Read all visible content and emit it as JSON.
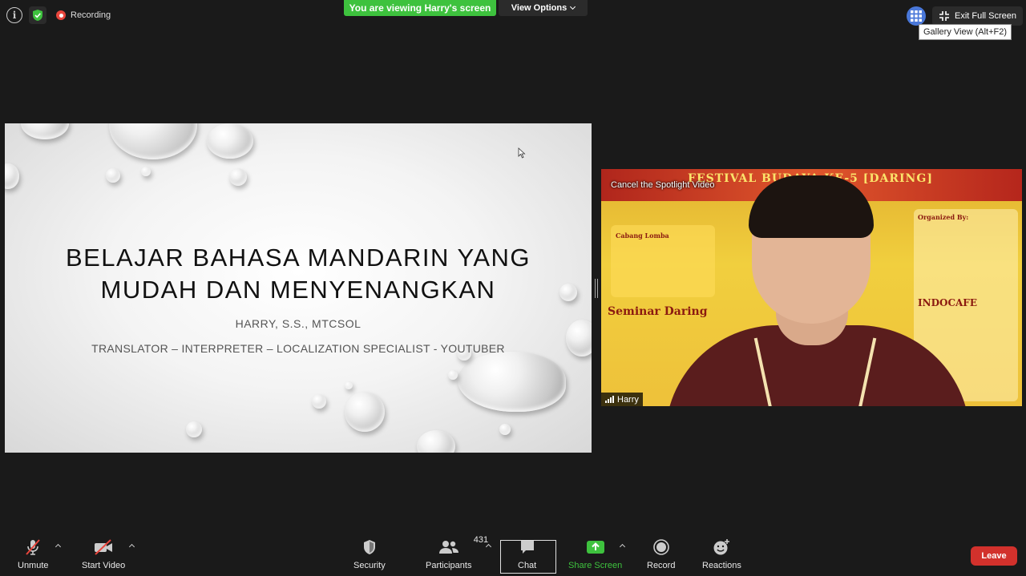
{
  "window": {
    "recording_label": "Recording",
    "viewing_banner": "You are viewing Harry's screen",
    "view_options_label": "View Options",
    "exit_fullscreen_label": "Exit Full Screen",
    "gallery_tooltip": "Gallery View (Alt+F2)"
  },
  "slide": {
    "title_line1": "BELAJAR BAHASA MANDARIN YANG",
    "title_line2": "MUDAH DAN MENYENANGKAN",
    "author": "HARRY, S.S., MTCSOL",
    "roles": "TRANSLATOR – INTERPRETER – LOCALIZATION SPECIALIST - YOUTUBER"
  },
  "video": {
    "spotlight_label": "Cancel the Spotlight Video",
    "participant_name": "Harry"
  },
  "toolbar": {
    "unmute_label": "Unmute",
    "start_video_label": "Start Video",
    "security_label": "Security",
    "participants_label": "Participants",
    "participants_count": "431",
    "chat_label": "Chat",
    "share_screen_label": "Share Screen",
    "record_label": "Record",
    "reactions_label": "Reactions",
    "leave_label": "Leave"
  },
  "colors": {
    "banner_green": "#3ec23e",
    "leave_red": "#d2312c",
    "gallery_blue": "#4a78d9",
    "background": "#1a1a1a"
  }
}
